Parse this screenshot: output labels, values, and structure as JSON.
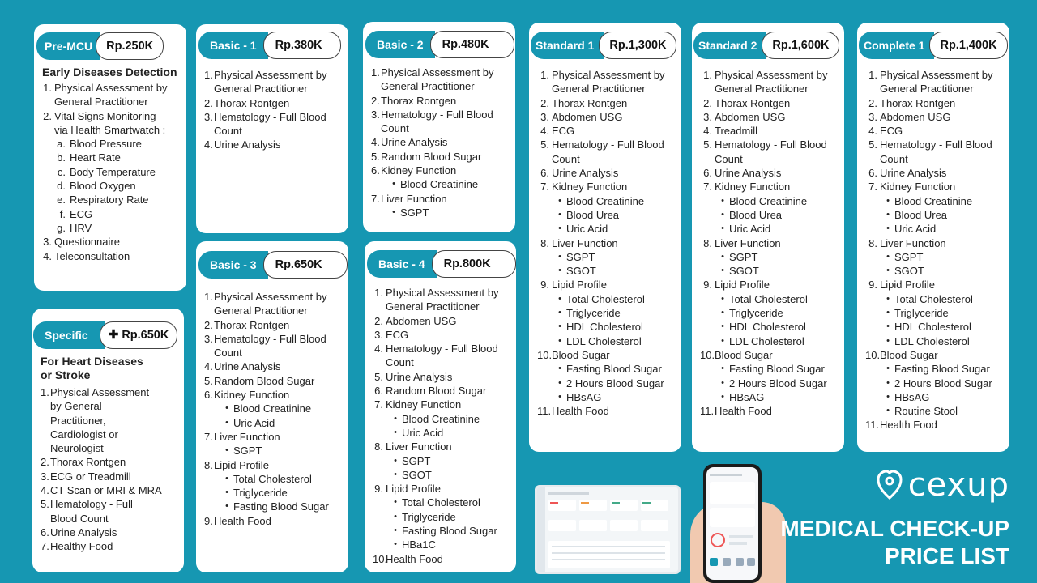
{
  "premcu": {
    "tag": "Pre-MCU",
    "price": "Rp.250K",
    "subtitle": "Early Diseases Detection",
    "items": [
      {
        "n": "1.",
        "text": "Physical Assessment by"
      },
      {
        "n": "",
        "text": "General Practitioner"
      },
      {
        "n": "2.",
        "text": "Vital Signs Monitoring"
      },
      {
        "n": "",
        "text": "via Health Smartwatch :"
      }
    ],
    "vitals": [
      {
        "n": "a.",
        "text": "Blood Pressure"
      },
      {
        "n": "b.",
        "text": "Heart Rate"
      },
      {
        "n": "c.",
        "text": "Body Temperature"
      },
      {
        "n": "d.",
        "text": "Blood Oxygen"
      },
      {
        "n": "e.",
        "text": "Respiratory Rate"
      },
      {
        "n": "f.",
        "text": "ECG"
      },
      {
        "n": "g.",
        "text": "HRV"
      }
    ],
    "tail": [
      {
        "n": "3.",
        "text": "Questionnaire"
      },
      {
        "n": "4.",
        "text": "Teleconsultation"
      }
    ]
  },
  "specific": {
    "tag": "Specific",
    "price": "Rp.650K",
    "plus": "✚",
    "subtitle1": "For Heart Diseases",
    "subtitle2": "or Stroke",
    "items": [
      {
        "n": "1.",
        "text": "Physical Assessment"
      },
      {
        "n": "",
        "text": "by General"
      },
      {
        "n": "",
        "text": "Practitioner,"
      },
      {
        "n": "",
        "text": "Cardiologist or"
      },
      {
        "n": "",
        "text": "Neurologist"
      },
      {
        "n": "2.",
        "text": "Thorax Rontgen"
      },
      {
        "n": "3.",
        "text": "ECG or Treadmill"
      },
      {
        "n": "4.",
        "text": "CT Scan or MRI & MRA"
      },
      {
        "n": "5.",
        "text": "Hematology - Full"
      },
      {
        "n": "",
        "text": "Blood Count"
      },
      {
        "n": "6.",
        "text": "Urine Analysis"
      },
      {
        "n": "7.",
        "text": "Healthy Food"
      }
    ]
  },
  "basic1": {
    "tag": "Basic - 1",
    "price": "Rp.380K",
    "items": [
      {
        "n": "1.",
        "text": "Physical Assessment by"
      },
      {
        "n": "",
        "text": "General Practitioner"
      },
      {
        "n": "2.",
        "text": "Thorax Rontgen"
      },
      {
        "n": "3.",
        "text": "Hematology - Full Blood"
      },
      {
        "n": "",
        "text": "Count"
      },
      {
        "n": "4.",
        "text": "Urine Analysis"
      }
    ]
  },
  "basic3": {
    "tag": "Basic - 3",
    "price": "Rp.650K",
    "items": [
      {
        "n": "1.",
        "text": "Physical Assessment by"
      },
      {
        "n": "",
        "text": "General Practitioner"
      },
      {
        "n": "2.",
        "text": "Thorax Rontgen"
      },
      {
        "n": "3.",
        "text": "Hematology - Full Blood"
      },
      {
        "n": "",
        "text": "Count"
      },
      {
        "n": "4.",
        "text": "Urine Analysis"
      },
      {
        "n": "5.",
        "text": "Random Blood Sugar"
      },
      {
        "n": "6.",
        "text": "Kidney Function"
      },
      {
        "n": "•",
        "text": "Blood Creatinine",
        "sub": true
      },
      {
        "n": "•",
        "text": "Uric Acid",
        "sub": true
      },
      {
        "n": "7.",
        "text": "Liver Function"
      },
      {
        "n": "•",
        "text": "SGPT",
        "sub": true
      },
      {
        "n": "8.",
        "text": "Lipid Profile"
      },
      {
        "n": "•",
        "text": "Total Cholesterol",
        "sub": true
      },
      {
        "n": "•",
        "text": "Triglyceride",
        "sub": true
      },
      {
        "n": "•",
        "text": "Fasting Blood Sugar",
        "sub": true
      },
      {
        "n": "9.",
        "text": "Health Food"
      }
    ]
  },
  "basic2": {
    "tag": "Basic - 2",
    "price": "Rp.480K",
    "items": [
      {
        "n": "1.",
        "text": "Physical Assessment by"
      },
      {
        "n": "",
        "text": "General Practitioner"
      },
      {
        "n": "2.",
        "text": "Thorax Rontgen"
      },
      {
        "n": "3.",
        "text": "Hematology - Full Blood"
      },
      {
        "n": "",
        "text": "Count"
      },
      {
        "n": "4.",
        "text": "Urine Analysis"
      },
      {
        "n": "5.",
        "text": "Random Blood Sugar"
      },
      {
        "n": "6.",
        "text": "Kidney Function"
      },
      {
        "n": "•",
        "text": "Blood Creatinine",
        "sub": true
      },
      {
        "n": "7.",
        "text": "Liver Function"
      },
      {
        "n": "•",
        "text": "SGPT",
        "sub": true
      }
    ]
  },
  "basic4": {
    "tag": "Basic - 4",
    "price": "Rp.800K",
    "items": [
      {
        "n": "1.",
        "text": "Physical Assessment by"
      },
      {
        "n": "",
        "text": "General Practitioner"
      },
      {
        "n": "2.",
        "text": "Abdomen USG"
      },
      {
        "n": "3.",
        "text": "ECG"
      },
      {
        "n": "4.",
        "text": "Hematology - Full Blood"
      },
      {
        "n": "",
        "text": "Count"
      },
      {
        "n": "5.",
        "text": "Urine Analysis"
      },
      {
        "n": "6.",
        "text": "Random Blood Sugar"
      },
      {
        "n": "7.",
        "text": "Kidney Function"
      },
      {
        "n": "•",
        "text": "Blood Creatinine",
        "sub": true
      },
      {
        "n": "•",
        "text": "Uric Acid",
        "sub": true
      },
      {
        "n": "8.",
        "text": "Liver Function"
      },
      {
        "n": "•",
        "text": "SGPT",
        "sub": true
      },
      {
        "n": "•",
        "text": "SGOT",
        "sub": true
      },
      {
        "n": "9.",
        "text": "Lipid Profile"
      },
      {
        "n": "•",
        "text": "Total Cholesterol",
        "sub": true
      },
      {
        "n": "•",
        "text": "Triglyceride",
        "sub": true
      },
      {
        "n": "•",
        "text": "Fasting Blood Sugar",
        "sub": true
      },
      {
        "n": "•",
        "text": "HBa1C",
        "sub": true
      },
      {
        "n": "10.",
        "text": "Health Food"
      }
    ]
  },
  "standard1": {
    "tag": "Standard 1",
    "price": "Rp.1,300K",
    "items": [
      {
        "n": "1.",
        "text": "Physical Assessment by"
      },
      {
        "n": "",
        "text": "General Practitioner"
      },
      {
        "n": "2.",
        "text": "Thorax Rontgen"
      },
      {
        "n": "3.",
        "text": "Abdomen USG"
      },
      {
        "n": "4.",
        "text": "ECG"
      },
      {
        "n": "5.",
        "text": "Hematology - Full Blood"
      },
      {
        "n": "",
        "text": "Count"
      },
      {
        "n": "6.",
        "text": "Urine Analysis"
      },
      {
        "n": "7.",
        "text": "Kidney Function"
      },
      {
        "n": "•",
        "text": "Blood Creatinine",
        "sub": true
      },
      {
        "n": "•",
        "text": "Blood Urea",
        "sub": true
      },
      {
        "n": "•",
        "text": "Uric Acid",
        "sub": true
      },
      {
        "n": "8.",
        "text": "Liver Function"
      },
      {
        "n": "•",
        "text": "SGPT",
        "sub": true
      },
      {
        "n": "•",
        "text": "SGOT",
        "sub": true
      },
      {
        "n": "9.",
        "text": "Lipid Profile"
      },
      {
        "n": "•",
        "text": "Total Cholesterol",
        "sub": true
      },
      {
        "n": "•",
        "text": "Triglyceride",
        "sub": true
      },
      {
        "n": "•",
        "text": "HDL Cholesterol",
        "sub": true
      },
      {
        "n": "•",
        "text": "LDL Cholesterol",
        "sub": true
      },
      {
        "n": "10.",
        "text": "Blood Sugar"
      },
      {
        "n": "•",
        "text": "Fasting Blood Sugar",
        "sub": true
      },
      {
        "n": "•",
        "text": "2 Hours Blood Sugar",
        "sub": true
      },
      {
        "n": "•",
        "text": "HBsAG",
        "sub": true
      },
      {
        "n": "11.",
        "text": "Health Food"
      }
    ]
  },
  "standard2": {
    "tag": "Standard 2",
    "price": "Rp.1,600K",
    "items": [
      {
        "n": "1.",
        "text": "Physical Assessment by"
      },
      {
        "n": "",
        "text": "General Practitioner"
      },
      {
        "n": "2.",
        "text": "Thorax Rontgen"
      },
      {
        "n": "3.",
        "text": "Abdomen USG"
      },
      {
        "n": "4.",
        "text": "Treadmill"
      },
      {
        "n": "5.",
        "text": "Hematology - Full Blood"
      },
      {
        "n": "",
        "text": "Count"
      },
      {
        "n": "6.",
        "text": "Urine Analysis"
      },
      {
        "n": "7.",
        "text": "Kidney Function"
      },
      {
        "n": "•",
        "text": "Blood Creatinine",
        "sub": true
      },
      {
        "n": "•",
        "text": "Blood Urea",
        "sub": true
      },
      {
        "n": "•",
        "text": "Uric Acid",
        "sub": true
      },
      {
        "n": "8.",
        "text": "Liver Function"
      },
      {
        "n": "•",
        "text": "SGPT",
        "sub": true
      },
      {
        "n": "•",
        "text": "SGOT",
        "sub": true
      },
      {
        "n": "9.",
        "text": "Lipid Profile"
      },
      {
        "n": "•",
        "text": "Total Cholesterol",
        "sub": true
      },
      {
        "n": "•",
        "text": "Triglyceride",
        "sub": true
      },
      {
        "n": "•",
        "text": "HDL Cholesterol",
        "sub": true
      },
      {
        "n": "•",
        "text": "LDL Cholesterol",
        "sub": true
      },
      {
        "n": "10.",
        "text": "Blood Sugar"
      },
      {
        "n": "•",
        "text": "Fasting Blood Sugar",
        "sub": true
      },
      {
        "n": "•",
        "text": "2 Hours Blood Sugar",
        "sub": true
      },
      {
        "n": "•",
        "text": "HBsAG",
        "sub": true
      },
      {
        "n": "11.",
        "text": "Health Food"
      }
    ]
  },
  "complete1": {
    "tag": "Complete 1",
    "price": "Rp.1,400K",
    "items": [
      {
        "n": "1.",
        "text": "Physical Assessment by"
      },
      {
        "n": "",
        "text": "General Practitioner"
      },
      {
        "n": "2.",
        "text": "Thorax Rontgen"
      },
      {
        "n": "3.",
        "text": "Abdomen USG"
      },
      {
        "n": "4.",
        "text": "ECG"
      },
      {
        "n": "5.",
        "text": "Hematology - Full Blood"
      },
      {
        "n": "",
        "text": "Count"
      },
      {
        "n": "6.",
        "text": "Urine Analysis"
      },
      {
        "n": "7.",
        "text": "Kidney Function"
      },
      {
        "n": "•",
        "text": "Blood Creatinine",
        "sub": true
      },
      {
        "n": "•",
        "text": "Blood Urea",
        "sub": true
      },
      {
        "n": "•",
        "text": "Uric Acid",
        "sub": true
      },
      {
        "n": "8.",
        "text": "Liver Function"
      },
      {
        "n": "•",
        "text": "SGPT",
        "sub": true
      },
      {
        "n": "•",
        "text": "SGOT",
        "sub": true
      },
      {
        "n": "9.",
        "text": "Lipid Profile"
      },
      {
        "n": "•",
        "text": "Total Cholesterol",
        "sub": true
      },
      {
        "n": "•",
        "text": "Triglyceride",
        "sub": true
      },
      {
        "n": "•",
        "text": "HDL Cholesterol",
        "sub": true
      },
      {
        "n": "•",
        "text": "LDL Cholesterol",
        "sub": true
      },
      {
        "n": "10.",
        "text": "Blood Sugar"
      },
      {
        "n": "•",
        "text": "Fasting Blood Sugar",
        "sub": true
      },
      {
        "n": "•",
        "text": "2 Hours Blood Sugar",
        "sub": true
      },
      {
        "n": "•",
        "text": "HBsAG",
        "sub": true
      },
      {
        "n": "•",
        "text": "Routine Stool",
        "sub": true
      },
      {
        "n": "11.",
        "text": "Health Food"
      }
    ]
  },
  "brand": {
    "logo": "cexup",
    "title1": "MEDICAL CHECK-UP",
    "title2": "PRICE LIST"
  },
  "colors": {
    "teal": "#1697b2",
    "card": "#ffffff",
    "text": "#222222"
  }
}
